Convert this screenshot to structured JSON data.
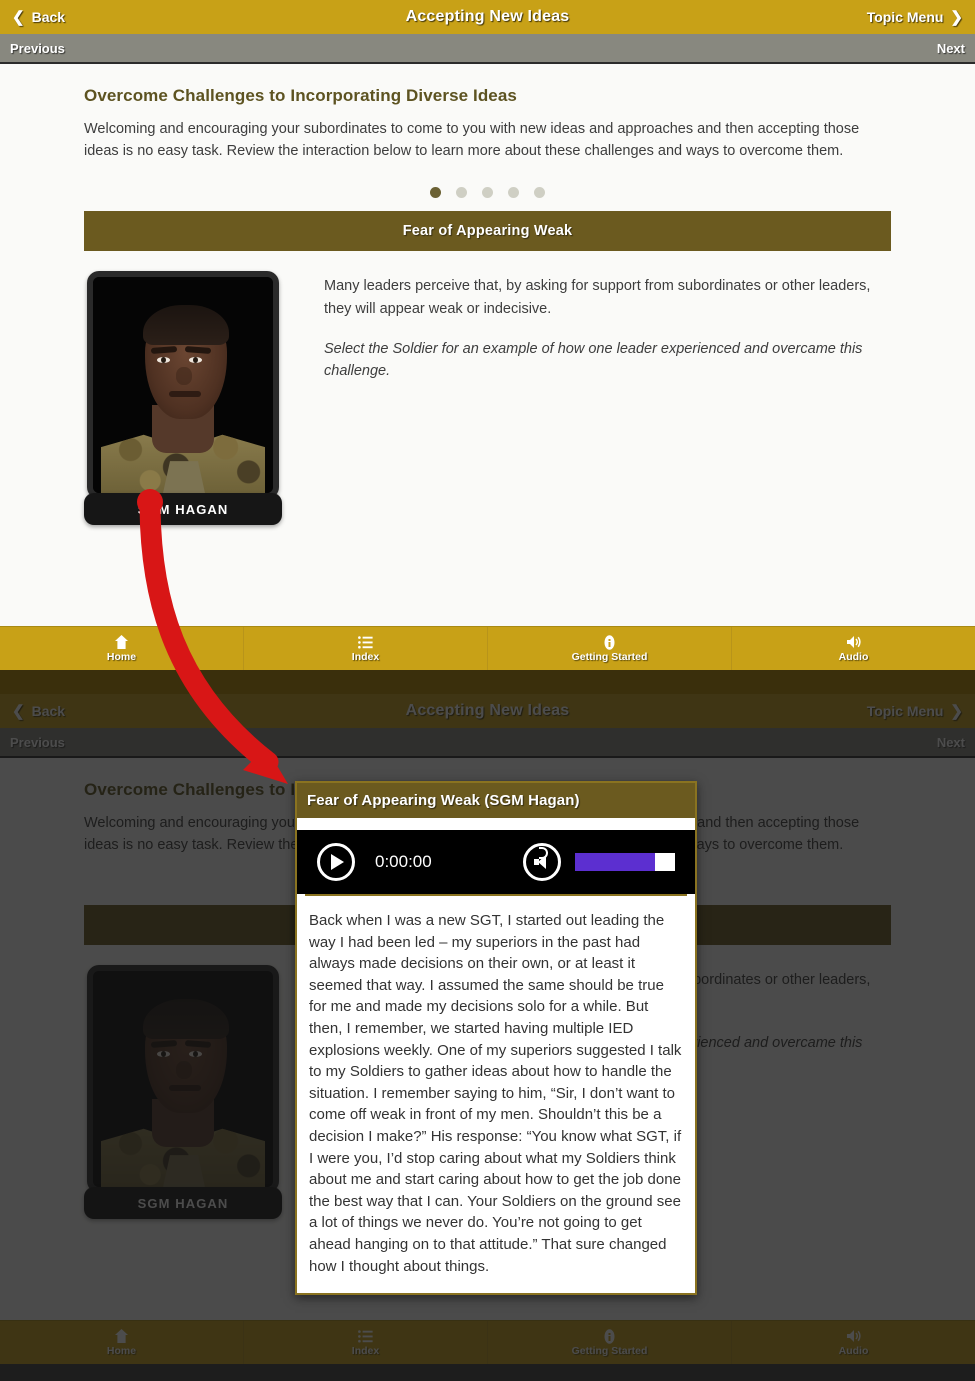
{
  "header": {
    "back_label": "Back",
    "title": "Accepting New Ideas",
    "topic_menu_label": "Topic Menu",
    "previous_label": "Previous",
    "next_label": "Next"
  },
  "page": {
    "heading": "Overcome Challenges to Incorporating Diverse Ideas",
    "intro": "Welcoming and encouraging your subordinates to come to you with new ideas and approaches and then accepting those ideas is no easy task. Review the interaction below to learn more about these challenges and ways to overcome them.",
    "pagination": {
      "total": 5,
      "active_index": 0
    }
  },
  "accordion": {
    "banner_title": "Fear of Appearing Weak",
    "soldier_name": "SGM HAGAN",
    "body_paragraph": "Many leaders perceive that, by asking for support from subordinates or other leaders, they will appear weak or indecisive.",
    "instruction": "Select the Soldier for an example of how one leader experienced and overcame this challenge."
  },
  "toolbar": {
    "items": [
      {
        "label": "Home",
        "icon": "home-icon"
      },
      {
        "label": "Index",
        "icon": "list-icon"
      },
      {
        "label": "Getting Started",
        "icon": "info-icon"
      },
      {
        "label": "Audio",
        "icon": "audio-icon"
      }
    ]
  },
  "modal": {
    "title": "Fear of Appearing Weak (SGM Hagan)",
    "player": {
      "timecode": "0:00:00",
      "play_icon": "play-icon",
      "volume_icon": "speaker-icon",
      "volume_percent": 80,
      "volume_fill_color": "#5c2fd0"
    },
    "transcript": "Back when I was a new SGT, I started out leading the way I had been led – my superiors in the past had always made decisions on their own, or at least it seemed that way. I assumed the same should be true for me and made my decisions solo for a while. But then, I remember, we started having multiple IED explosions weekly. One of my superiors suggested I talk to my Soldiers to gather ideas about how to handle the situation. I remember saying to him, “Sir, I don’t want to come off weak in front of my men. Shouldn’t this be a decision I make?” His response: “You know what SGT, if I were you, I’d stop caring about what my Soldiers think about me and start caring about how to get the job done the best way that I can. Your Soldiers on the ground see a lot of things we never do. You’re not going to get ahead hanging on to that attitude.” That sure changed how I thought about things."
  },
  "annotation": {
    "arrow_color": "#d81616",
    "description": "red curved arrow from SGM Hagan nameplate to the opened modal"
  },
  "colors": {
    "gold_bar": "#c8a117",
    "banner_brown": "#6b5a1f",
    "grey_bar": "#88887f",
    "heading_olive": "#5d5321"
  }
}
